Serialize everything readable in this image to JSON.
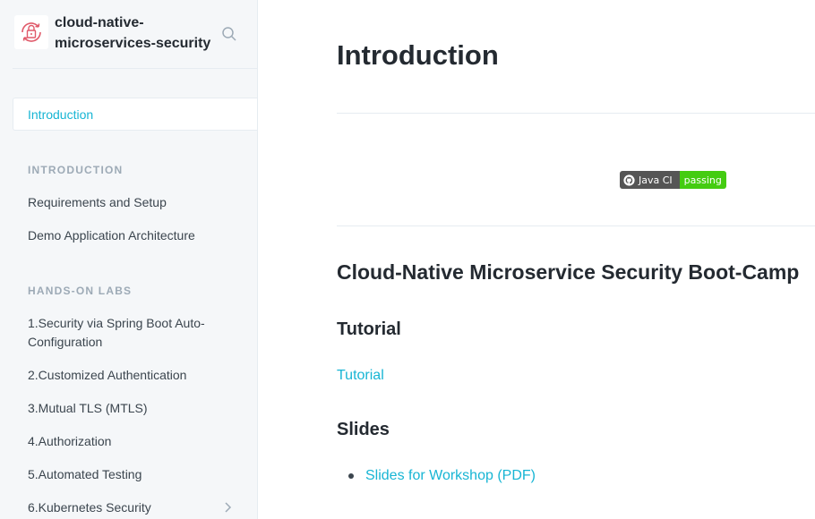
{
  "sidebar": {
    "brand_title": "cloud-native-microservices-security",
    "logo_icon": "lock-refresh-icon",
    "search_icon": "search-icon",
    "active_item": "Introduction",
    "sections": [
      {
        "title": "INTRODUCTION",
        "items": [
          "Requirements and Setup",
          "Demo Application Architecture"
        ]
      },
      {
        "title": "HANDS-ON LABS",
        "items": [
          "1.Security via Spring Boot Auto-Configuration",
          "2.Customized Authentication",
          "3.Mutual TLS (MTLS)",
          "4.Authorization",
          "5.Automated Testing",
          "6.Kubernetes Security"
        ]
      }
    ],
    "expand_icon": "chevron-right-icon"
  },
  "main": {
    "title": "Introduction",
    "badge": {
      "label": "Java CI",
      "status": "passing",
      "icon": "github-icon",
      "label_color": "#555555",
      "status_color": "#44cc11"
    },
    "heading": "Cloud-Native Microservice Security Boot-Camp",
    "tutorial_heading": "Tutorial",
    "tutorial_link": "Tutorial",
    "slides_heading": "Slides",
    "slides_link": "Slides for Workshop (PDF)"
  },
  "colors": {
    "accent": "#17b5d4",
    "sidebar_bg": "#f5f7f9",
    "text": "#3b454e",
    "heading": "#242a31"
  }
}
